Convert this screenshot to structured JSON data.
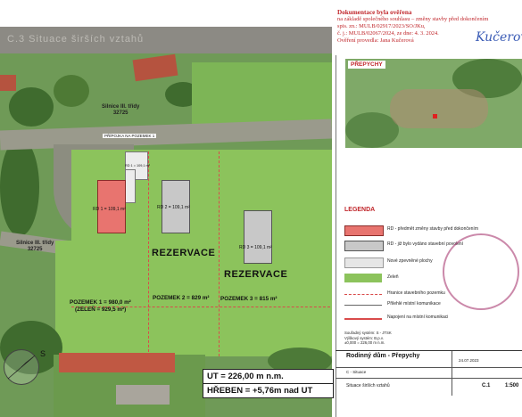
{
  "banner": {
    "title": "C.3 Situace širších vztahů"
  },
  "stamp": {
    "title": "Dokumentace byla ověřena",
    "lines": [
      "na základě společného souhlasu – změny stavby před dokončením",
      "spis. zn.: MULB/02917/2023/SO/JKu,",
      "č. j.: MULB/02067/2024, ze dne: 4. 3. 2024.",
      "Ověření provedla: Jana Kučerová"
    ],
    "signature": "Kučerová"
  },
  "overview": {
    "label": "PŘEPYCHY"
  },
  "roads": {
    "top": [
      "Silnice III. třídy",
      "32725"
    ],
    "left": [
      "Silnice III. třídy",
      "32725"
    ]
  },
  "annotations": {
    "connection": "PŘÍPOJKA NA POZEMEK 1",
    "small": "RD 1 = 109,1 m²"
  },
  "houses": {
    "rd1": "RD 1 = 109,1 m²",
    "rd2": "RD 2 = 109,1 m²",
    "rd3": "RD 3 = 109,1 m²"
  },
  "reservations": [
    "REZERVACE",
    "REZERVACE"
  ],
  "plots": {
    "p1_line1": "POZEMEK 1 = 980,0 m²",
    "p1_line2": "(ZELEŇ = 929,5 m²)",
    "p2": "POZEMEK 2 = 829 m²",
    "p3": "POZEMEK 3 = 815 m²"
  },
  "elevation": {
    "ut": "UT = 226,00 m n.m.",
    "hreben": "HŘEBEN = +5,76m nad UT"
  },
  "compass": {
    "letter": "S"
  },
  "legend": {
    "title": "LEGENDA",
    "items": [
      {
        "text": "RD - předmět změny stavby před dokončením",
        "color": "#e8746f"
      },
      {
        "text": "RD - již bylo vydáno stavební povolení",
        "color": "#c8c8c8"
      },
      {
        "text": "Nové zpevněné plochy",
        "color": "#e6e6e6"
      },
      {
        "text": "Zeleň",
        "color": "#8cc35c"
      },
      {
        "text": "Hranice stavebního pozemku",
        "color": "#d94b4b"
      },
      {
        "text": "Přilehlé místní komunikace",
        "color": "#ffffff"
      },
      {
        "text": "Napojení na místní komunikaci",
        "color": "#ffffff"
      }
    ]
  },
  "info": {
    "line1": "Souřadný systém:    S - JTSK",
    "line2": "Výškový systém:    B.p.v.",
    "line3": "±0,000 = 226,00 m n.m."
  },
  "title_block": {
    "project": "Rodinný dům - Přepychy",
    "place": "C - Situace",
    "drawing": "Situace širších vztahů",
    "number": "C.1",
    "scale": "1:500",
    "date": "24.07.2023"
  }
}
